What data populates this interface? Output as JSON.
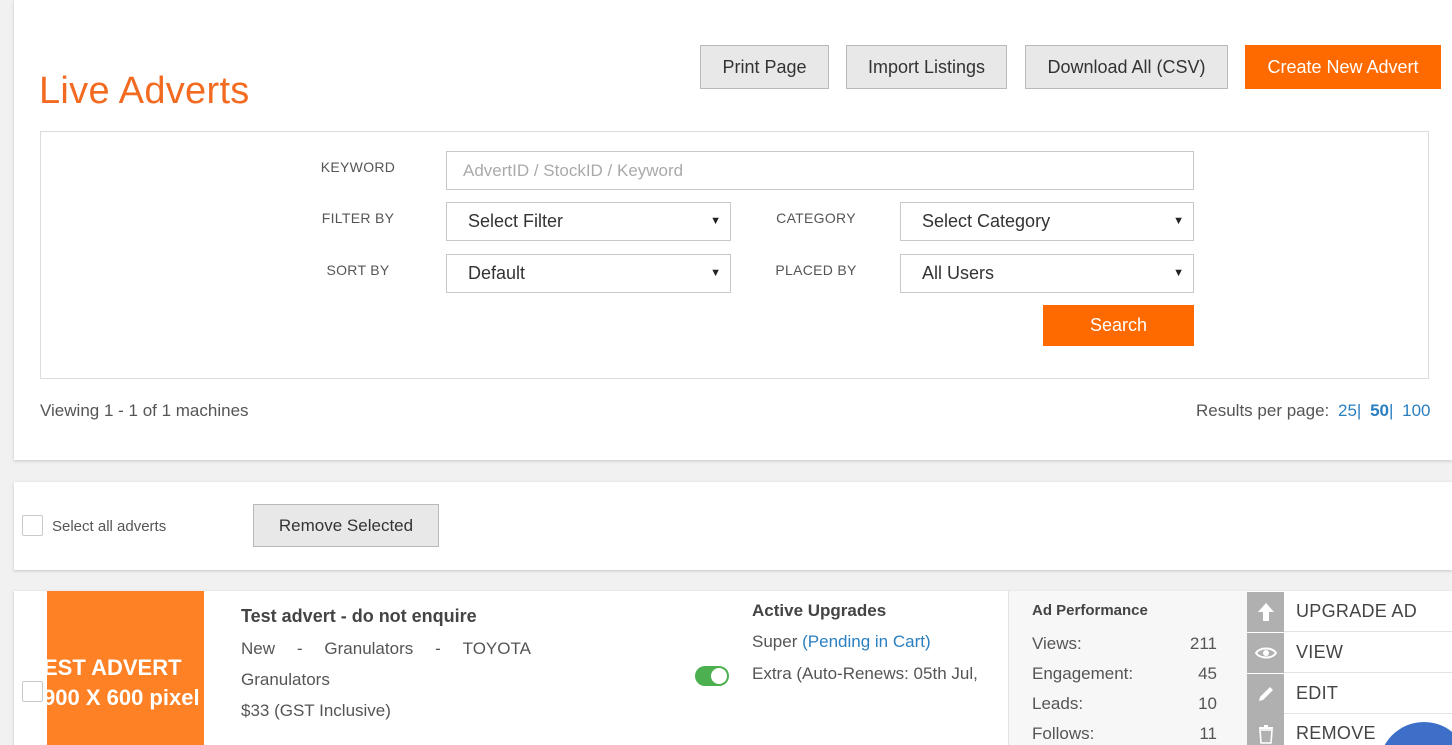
{
  "page": {
    "title": "Live Adverts"
  },
  "toolbar": {
    "print_label": "Print Page",
    "import_label": "Import Listings",
    "download_label": "Download All (CSV)",
    "create_label": "Create New Advert"
  },
  "filters": {
    "keyword_label": "KEYWORD",
    "keyword_placeholder": "AdvertID / StockID / Keyword",
    "filter_by_label": "FILTER BY",
    "filter_by_value": "Select Filter",
    "category_label": "CATEGORY",
    "category_value": "Select Category",
    "sort_by_label": "SORT BY",
    "sort_by_value": "Default",
    "placed_by_label": "PLACED BY",
    "placed_by_value": "All Users",
    "search_label": "Search"
  },
  "results": {
    "viewing_text": "Viewing 1 - 1 of 1 machines",
    "per_page_label": "Results per page:",
    "per_page_options": [
      "25",
      "50",
      "100"
    ],
    "separator": "|"
  },
  "bulk": {
    "select_all_label": "Select all adverts",
    "remove_selected_label": "Remove Selected"
  },
  "listing": {
    "thumb_line1": "EST ADVERT",
    "thumb_line2": "900 X 600 pixel",
    "title": "Test advert - do not enquire",
    "condition": "New",
    "sep": "-",
    "category": "Granulators",
    "make": "TOYOTA",
    "model": "Granulators",
    "price": "$33 (GST Inclusive)",
    "upgrades_title": "Active Upgrades",
    "upgrade1_name": "Super",
    "upgrade1_status": "(Pending in Cart)",
    "upgrade2": "Extra (Auto-Renews: 05th Jul,",
    "toggle_on": true,
    "performance": {
      "title": "Ad Performance",
      "rows": [
        {
          "label": "Views:",
          "value": "211"
        },
        {
          "label": "Engagement:",
          "value": "45"
        },
        {
          "label": "Leads:",
          "value": "10"
        },
        {
          "label": "Follows:",
          "value": "11"
        }
      ]
    },
    "actions": [
      {
        "label": "UPGRADE AD",
        "icon": "arrow-up-icon"
      },
      {
        "label": "VIEW",
        "icon": "eye-icon"
      },
      {
        "label": "EDIT",
        "icon": "pencil-icon"
      },
      {
        "label": "REMOVE",
        "icon": "trash-icon"
      }
    ]
  },
  "colors": {
    "accent": "#ff6a00",
    "title": "#f26b21",
    "link": "#2a7fc1",
    "toggle": "#4cb050"
  }
}
